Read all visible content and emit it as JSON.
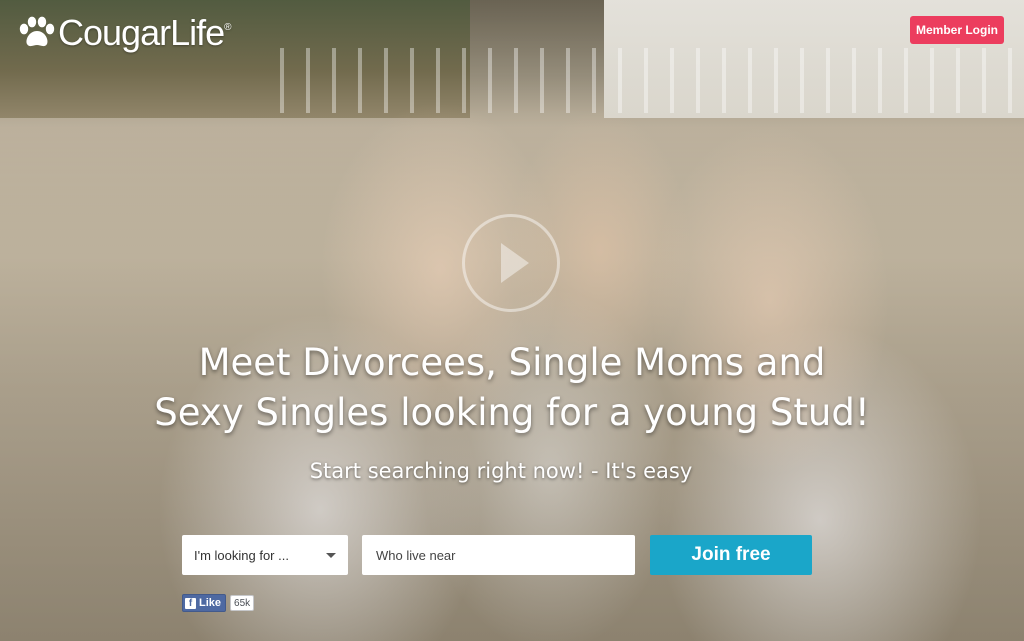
{
  "brand": {
    "name": "CougarLife",
    "trademark": "®"
  },
  "header": {
    "login_label": "Member Login"
  },
  "hero": {
    "headline_line1": "Meet Divorcees, Single Moms and",
    "headline_line2": "Sexy Singles looking for a young Stud!",
    "subheadline": "Start searching right now! - It's easy"
  },
  "search_form": {
    "looking_for_value": "I'm looking for ...",
    "location_placeholder": "Who live near",
    "join_label": "Join free"
  },
  "social": {
    "fb_like_label": "Like",
    "fb_like_count": "65k"
  },
  "colors": {
    "accent_login": "#ec3d5e",
    "accent_join": "#1aa6c9",
    "facebook": "#4e69a2"
  }
}
